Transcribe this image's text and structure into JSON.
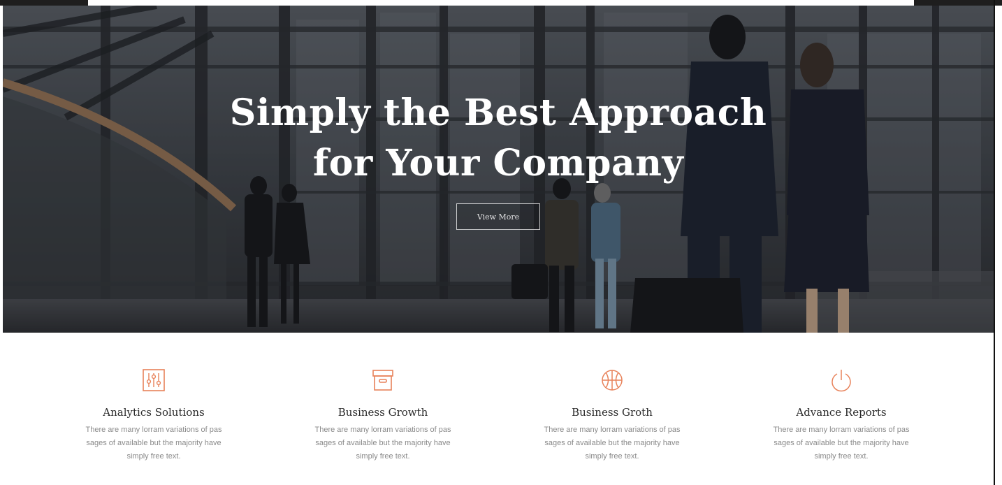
{
  "hero": {
    "title_line1": "Simply the Best Approach",
    "title_line2": "for Your Company",
    "button_label": "View More"
  },
  "features": [
    {
      "icon": "sliders-icon",
      "title": "Analytics Solutions",
      "text": "There are many lorram variations of pas sages of available but the majority have simply free text."
    },
    {
      "icon": "archive-box-icon",
      "title": "Business Growth",
      "text": "There are many lorram variations of pas sages of available but the majority have simply free text."
    },
    {
      "icon": "basketball-icon",
      "title": "Business Groth",
      "text": "There are many lorram variations of pas sages of available but the majority have simply free text."
    },
    {
      "icon": "power-icon",
      "title": "Advance Reports",
      "text": "There are many lorram variations of pas sages of available but the majority have simply free text."
    }
  ],
  "colors": {
    "accent": "#e8825a",
    "title_text": "#2a2a2a",
    "body_text": "#8a8a8a"
  }
}
